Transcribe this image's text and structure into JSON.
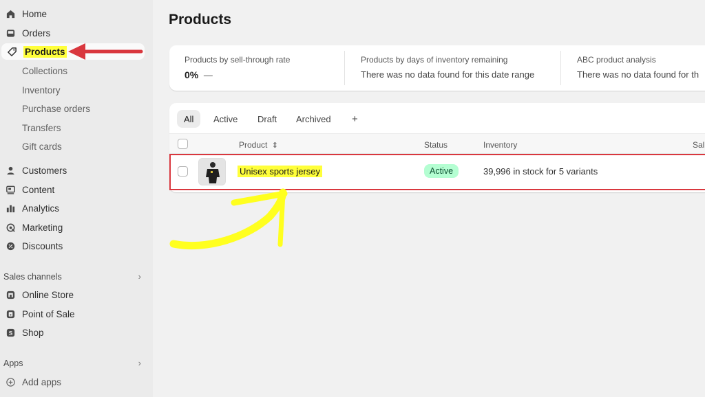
{
  "sidebar": {
    "items": [
      {
        "label": "Home",
        "icon": "home-icon"
      },
      {
        "label": "Orders",
        "icon": "inbox-icon"
      },
      {
        "label": "Products",
        "icon": "tag-icon",
        "active": true
      },
      {
        "label": "Customers",
        "icon": "person-icon"
      },
      {
        "label": "Content",
        "icon": "content-icon"
      },
      {
        "label": "Analytics",
        "icon": "bar-chart-icon"
      },
      {
        "label": "Marketing",
        "icon": "target-icon"
      },
      {
        "label": "Discounts",
        "icon": "discount-gear-icon"
      }
    ],
    "product_sub": [
      "Collections",
      "Inventory",
      "Purchase orders",
      "Transfers",
      "Gift cards"
    ],
    "sales_channels": {
      "title": "Sales channels",
      "items": [
        {
          "label": "Online Store",
          "icon": "store-icon"
        },
        {
          "label": "Point of Sale",
          "icon": "pos-icon"
        },
        {
          "label": "Shop",
          "icon": "shop-icon"
        }
      ]
    },
    "apps": {
      "title": "Apps",
      "add_label": "Add apps"
    }
  },
  "main": {
    "title": "Products",
    "metrics": [
      {
        "title": "Products by sell-through rate",
        "value": "0%",
        "trend": "—"
      },
      {
        "title": "Products by days of inventory remaining",
        "value": "There was no data found for this date range"
      },
      {
        "title": "ABC product analysis",
        "value": "There was no data found for th"
      }
    ],
    "tabs": [
      "All",
      "Active",
      "Draft",
      "Archived",
      "+"
    ],
    "columns": [
      "Product",
      "Status",
      "Inventory",
      "Sal"
    ],
    "rows": [
      {
        "name": "Unisex sports jersey",
        "status": "Active",
        "inventory": "39,996 in stock for 5 variants"
      }
    ]
  },
  "colors": {
    "highlight_yellow": "#ffff3a",
    "annotation_red": "#d9373e",
    "active_badge_bg": "#b4fed2"
  }
}
